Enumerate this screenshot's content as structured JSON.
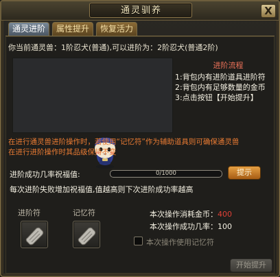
{
  "window": {
    "title": "通灵驯养",
    "close_label": "X"
  },
  "tabs": [
    {
      "label": "通灵进阶",
      "active": true
    },
    {
      "label": "属性提升",
      "active": false
    },
    {
      "label": "恢复活力",
      "active": false
    }
  ],
  "current": {
    "text": "你当前通灵兽：1阶忍犬(普通),可以进阶为：2阶忍犬(普通2阶)"
  },
  "process": {
    "title": "进阶流程",
    "steps": [
      "1:背包内有进阶道具进阶符",
      "2:背包内有足够数量的金币",
      "3:点击按钮【开始提升】"
    ]
  },
  "warning": {
    "line1": "在进行通灵兽进阶操作时，若使用“记忆符”作为辅助道具则可确保通灵兽",
    "line2": "在进行进阶操作时其品级保持不变"
  },
  "bless": {
    "label": "进阶成功几率祝福值:",
    "value_text": "0/1000",
    "current": 0,
    "max": 1000,
    "hint_button": "提示",
    "fail_text": "每次进阶失败增加祝福值,值越高则下次进阶成功率越高"
  },
  "items": {
    "advance_label": "进阶符",
    "memory_label": "记忆符"
  },
  "operation": {
    "cost_label": "本次操作消耗金币：",
    "cost_value": "400",
    "rate_label": "本次操作成功几率：",
    "rate_value": "100",
    "memo_label": "本次操作使用记忆符",
    "memo_checked": false,
    "start_button": "开始提升"
  },
  "colors": {
    "accent_orange": "#e97b33",
    "cost_red": "#e04036",
    "process_title": "#f0735a"
  }
}
